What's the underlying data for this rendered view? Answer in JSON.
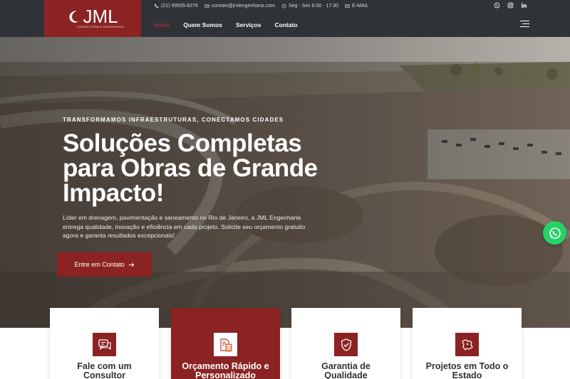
{
  "brand": {
    "logo_text": "JML",
    "logo_sub": "CONSULTORIA E ENGENHARIA",
    "primary_color": "#8b2323",
    "header_bg": "#2f3236"
  },
  "topbar": {
    "phone": "(21) 99555-8276",
    "email": "contato@jmlengenharia.com",
    "hours": "Seg - Sex 8:00 - 17:30",
    "email_link": "E-MAIL"
  },
  "social": [
    "whatsapp-icon",
    "instagram-icon",
    "linkedin-icon"
  ],
  "nav": {
    "items": [
      "Início",
      "Quem Somos",
      "Serviços",
      "Contato"
    ],
    "active": "Início"
  },
  "hero": {
    "eyebrow": "TRANSFORMAMOS INFRAESTRUTURAS, CONECTAMOS CIDADES",
    "headline": "Soluções Completas para Obras de Grande Impacto!",
    "description": "Líder em drenagem, pavimentação e saneamento no Rio de Janeiro, a JML Engenharia entrega qualidade, inovação e eficiência em cada projeto. Solicite seu orçamento gratuito agora e garanta resultados excepcionais!",
    "cta_label": "Entre em Contato"
  },
  "cards": [
    {
      "title": "Fale com um Consultor",
      "icon": "chat-icon"
    },
    {
      "title": "Orçamento Rápido e Personalizado",
      "icon": "document-calculator-icon"
    },
    {
      "title": "Garantia de Qualidade",
      "icon": "shield-check-icon"
    },
    {
      "title": "Projetos em Todo o Estado",
      "icon": "map-icon"
    }
  ]
}
